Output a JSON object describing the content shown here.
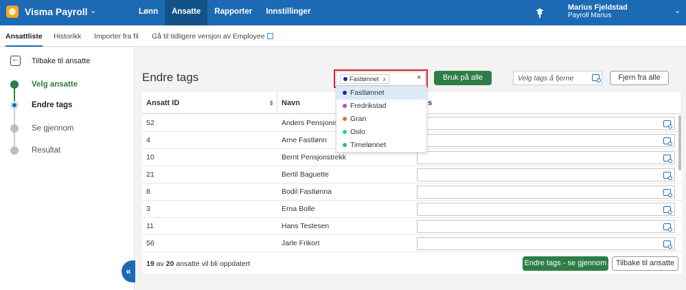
{
  "app": {
    "name": "Visma Payroll"
  },
  "nav": {
    "items": [
      "Lønn",
      "Ansatte",
      "Rapporter",
      "Innstillinger"
    ],
    "active": "Ansatte"
  },
  "user": {
    "name": "Marius Fjeldstad",
    "org": "Payroll Marius"
  },
  "subnav": {
    "tabs": [
      "Ansattliste",
      "Historikk",
      "Importer fra fil",
      "Gå til tidligere versjon av Employee"
    ],
    "active": "Ansattliste"
  },
  "sidebar": {
    "back_label": "Tilbake til ansatte",
    "steps": [
      {
        "label": "Velg ansatte",
        "state": "done"
      },
      {
        "label": "Endre tags",
        "state": "current"
      },
      {
        "label": "Se gjennom",
        "state": "pending"
      },
      {
        "label": "Resultat",
        "state": "pending"
      }
    ]
  },
  "main": {
    "title": "Endre tags",
    "tag_select": {
      "chip": "Fastlønnet",
      "chip_remove": "x",
      "clear": "×"
    },
    "apply_all": "Bruk på alle",
    "remove_placeholder": "Velg tags å fjerne",
    "remove_all": "Fjern fra alle"
  },
  "dropdown": {
    "options": [
      {
        "label": "Fastlønnet",
        "color": "#1428b4",
        "selected": true
      },
      {
        "label": "Fredrikstad",
        "color": "#d63ad6"
      },
      {
        "label": "Gran",
        "color": "#e8711c"
      },
      {
        "label": "Oslo",
        "color": "#1fd3a5"
      },
      {
        "label": "Timelønnet",
        "color": "#22c55e"
      }
    ]
  },
  "table": {
    "columns": [
      "Ansatt ID",
      "Navn",
      "Tags"
    ],
    "header_tags_visible": "s",
    "rows": [
      {
        "id": "52",
        "name": "Anders Pensjonist"
      },
      {
        "id": "4",
        "name": "Arne Fastlønn"
      },
      {
        "id": "10",
        "name": "Bernt Pensjonstrekk"
      },
      {
        "id": "21",
        "name": "Bertil Baguette"
      },
      {
        "id": "8",
        "name": "Bodil Fastlønna"
      },
      {
        "id": "3",
        "name": "Erna Bolle"
      },
      {
        "id": "11",
        "name": "Hans Testesen"
      },
      {
        "id": "56",
        "name": "Jarle Frikort"
      }
    ]
  },
  "footer": {
    "count_selected": "19",
    "count_of": "av",
    "count_total": "20",
    "count_suffix": "ansatte vil bli oppdatert",
    "review_button": "Endre tags - se gjennom",
    "back_button": "Tilbake til ansatte"
  },
  "colors": {
    "brand": "#1b6ab3",
    "primary_green": "#2e7d46",
    "highlight": "#d0232e"
  }
}
